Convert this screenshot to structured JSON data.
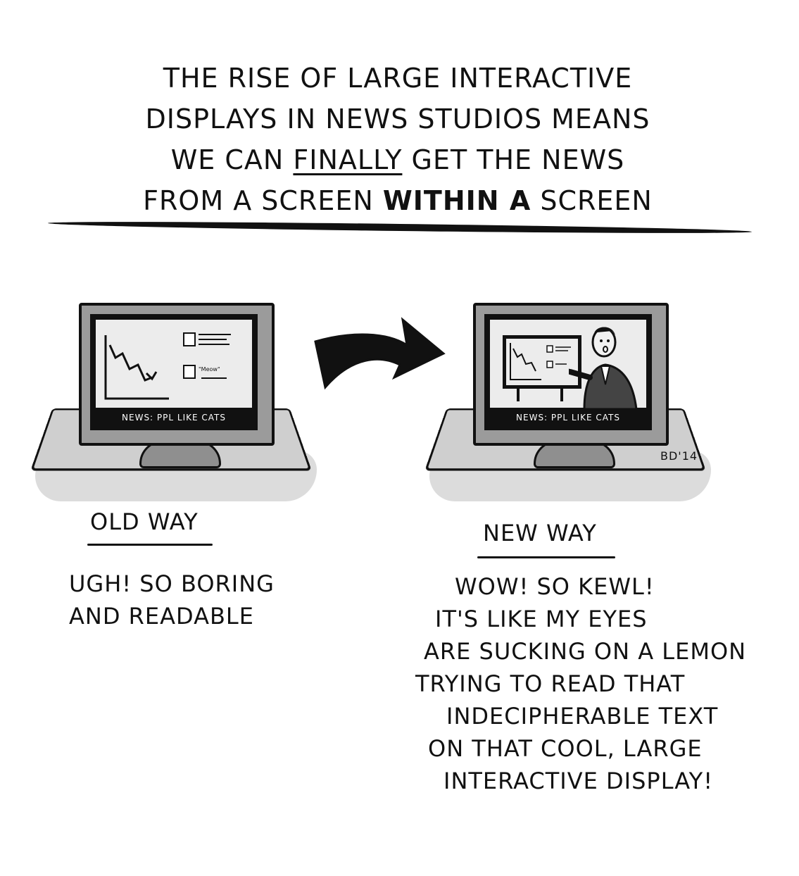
{
  "header": {
    "line1": "The rise of large interactive",
    "line2": "displays in news studios means",
    "line3_a": "we can",
    "line3_u": "finally",
    "line3_b": "get the news",
    "line4_a": "from a screen",
    "line4_bold": "within a",
    "line4_c": "screen"
  },
  "old_panel": {
    "ticker": "News: PPL like cats",
    "meow": "\"Meow\""
  },
  "new_panel": {
    "ticker": "News: PPL like cats",
    "signature": "BD'14"
  },
  "old_caption": {
    "title": "Old way",
    "lines": [
      "Ugh! So boring",
      "and readable"
    ]
  },
  "new_caption": {
    "title": "New way",
    "lines": [
      "Wow! So kewl!",
      "It's like my eyes",
      "are sucking on a lemon",
      "trying to read that",
      "indecipherable text",
      "on that cool, large",
      "interactive display!"
    ]
  }
}
